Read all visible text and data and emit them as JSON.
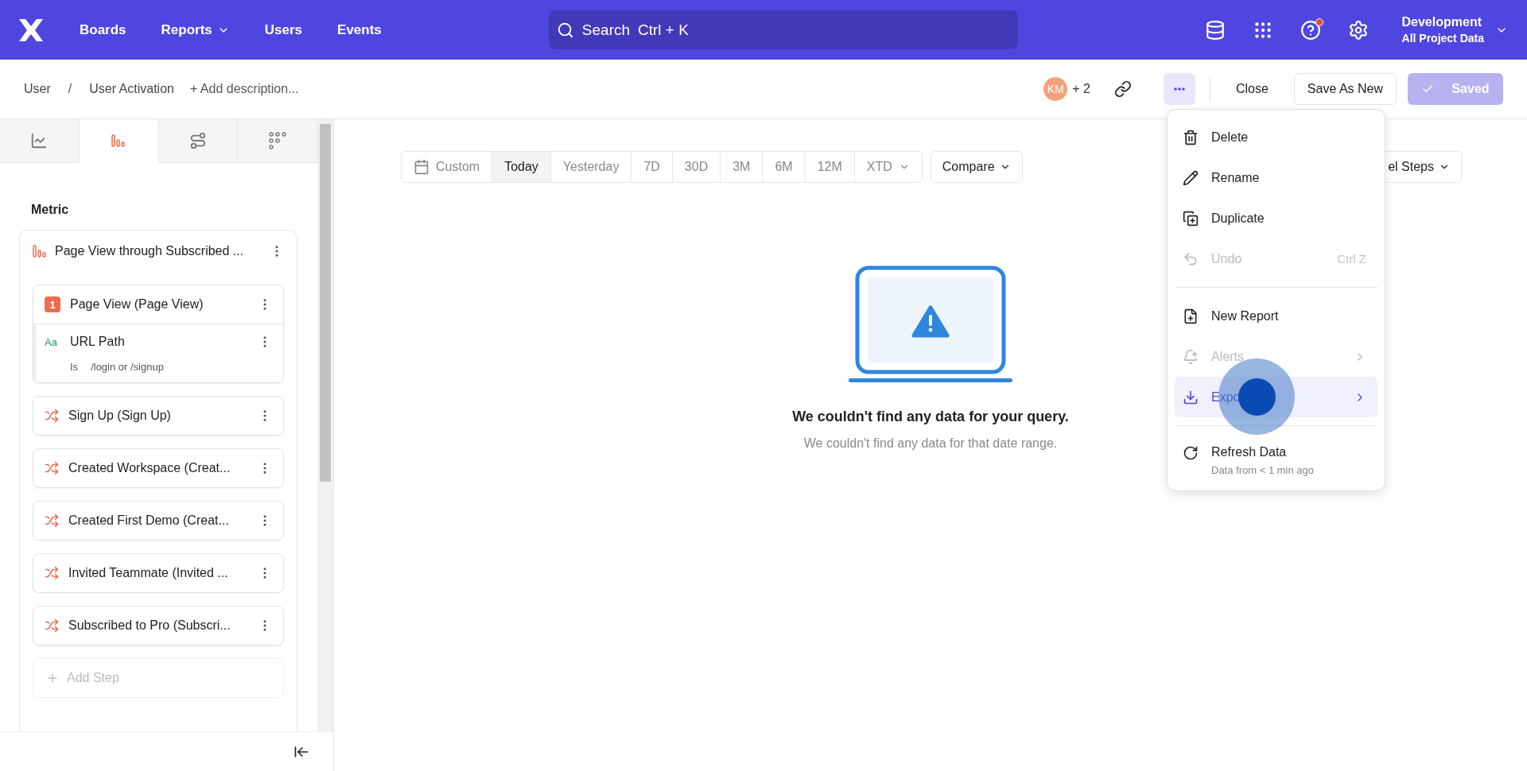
{
  "topbar": {
    "nav": [
      {
        "label": "Boards",
        "has_menu": false
      },
      {
        "label": "Reports",
        "has_menu": true
      },
      {
        "label": "Users",
        "has_menu": false
      },
      {
        "label": "Events",
        "has_menu": false
      }
    ],
    "search": {
      "label": "Search",
      "shortcut": "Ctrl + K"
    },
    "help_notification": true,
    "project": {
      "name": "Development",
      "scope": "All Project Data"
    }
  },
  "header": {
    "breadcrumb": [
      "User",
      "User Activation"
    ],
    "separator": "/",
    "add_description": "+ Add description...",
    "collaborators": {
      "initials": "KM",
      "more": "+ 2"
    },
    "more_open": true,
    "close": "Close",
    "save_as_new": "Save As New",
    "saved": {
      "label": "Saved",
      "disabled": true
    }
  },
  "sidebar": {
    "tabs": [
      {
        "selected": false
      },
      {
        "selected": true
      },
      {
        "selected": false
      },
      {
        "selected": false
      }
    ],
    "section_title": "Metric",
    "metric_name": "Page View through Subscribed ...",
    "steps": [
      {
        "kind": "numbered",
        "badge": "1",
        "label": "Page View (Page View)",
        "filter": {
          "type_badge": "Aa",
          "property": "URL Path",
          "operator": "Is",
          "value": "/login or /signup"
        }
      },
      {
        "kind": "event",
        "label": "Sign Up (Sign Up)"
      },
      {
        "kind": "event",
        "label": "Created Workspace (Creat..."
      },
      {
        "kind": "event",
        "label": "Created First Demo (Creat..."
      },
      {
        "kind": "event",
        "label": "Invited Teammate (Invited ..."
      },
      {
        "kind": "event",
        "label": "Subscribed to Pro (Subscri..."
      }
    ],
    "add_step": {
      "label": "Add Step",
      "disabled": true
    }
  },
  "toolbar": {
    "date_options": [
      {
        "label": "Custom",
        "selected": false
      },
      {
        "label": "Today",
        "selected": true
      },
      {
        "label": "Yesterday",
        "selected": false
      },
      {
        "label": "7D",
        "selected": false
      },
      {
        "label": "30D",
        "selected": false
      },
      {
        "label": "3M",
        "selected": false
      },
      {
        "label": "6M",
        "selected": false
      },
      {
        "label": "12M",
        "selected": false
      },
      {
        "label": "XTD",
        "selected": false
      }
    ],
    "compare": "Compare",
    "view_button": "el Steps"
  },
  "empty_state": {
    "title": "We couldn't find any data for your query.",
    "message": "We couldn't find any data for that date range."
  },
  "menu": {
    "items": [
      {
        "kind": "action",
        "label": "Delete",
        "disabled": false
      },
      {
        "kind": "action",
        "label": "Rename",
        "disabled": false
      },
      {
        "kind": "action",
        "label": "Duplicate",
        "disabled": false
      },
      {
        "kind": "action",
        "label": "Undo",
        "disabled": true,
        "shortcut": "Ctrl Z"
      },
      {
        "kind": "divider"
      },
      {
        "kind": "action",
        "label": "New Report",
        "disabled": false
      },
      {
        "kind": "submenu",
        "label": "Alerts",
        "disabled": true
      },
      {
        "kind": "submenu",
        "label": "Expo",
        "disabled": false,
        "highlighted": true,
        "click_marker": true
      },
      {
        "kind": "divider"
      },
      {
        "kind": "action",
        "label": "Refresh Data",
        "disabled": false,
        "note": "Data from < 1 min ago"
      }
    ]
  }
}
